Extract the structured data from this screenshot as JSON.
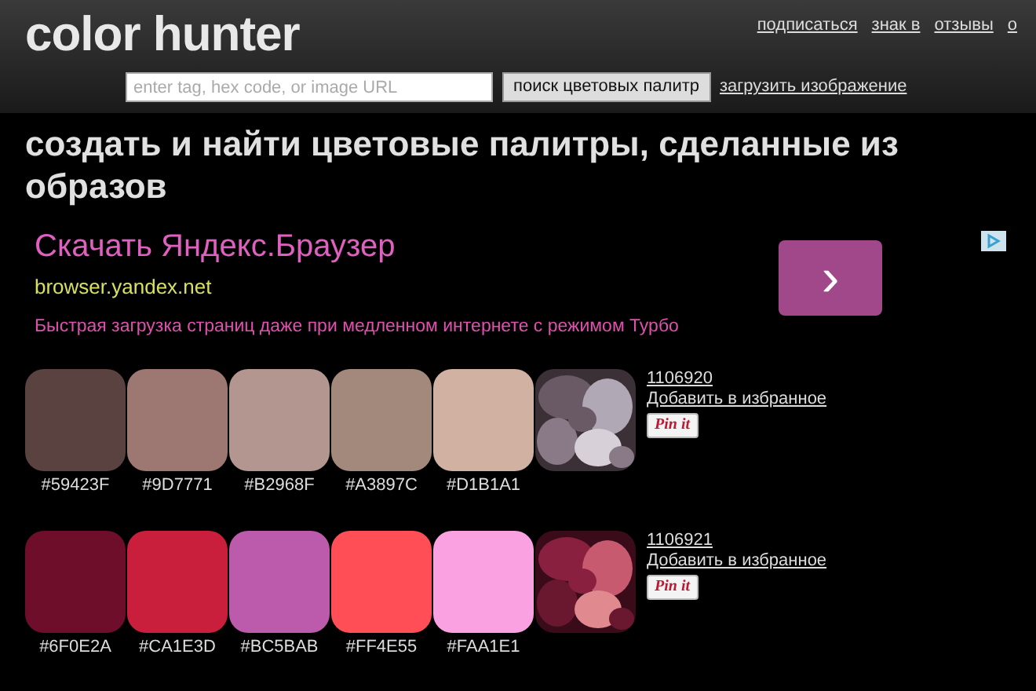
{
  "header": {
    "logo": "color hunter",
    "nav": [
      "подписаться",
      "знак в",
      "отзывы",
      "о"
    ],
    "search": {
      "placeholder": "enter tag, hex code, or image URL"
    },
    "search_button": "поиск цветовых палитр",
    "upload_link": "загрузить изображение"
  },
  "heading": "создать и найти цветовые палитры, сделанные из образов",
  "ad": {
    "title": "Скачать Яндекс.Браузер",
    "url": "browser.yandex.net",
    "description": "Быстрая загрузка страниц даже при медленном интернете с режимом Турбо",
    "button": "›"
  },
  "palettes": [
    {
      "id": "1106920",
      "favorite": "Добавить в избранное",
      "pin": "Pin it",
      "swatches": [
        {
          "label": "#59423F",
          "color": "#59423f"
        },
        {
          "label": "#9D7771",
          "color": "#9d7771"
        },
        {
          "label": "#B2968F",
          "color": "#b2968f"
        },
        {
          "label": "#A3897C",
          "color": "#a3897c"
        },
        {
          "label": "#D1B1A1",
          "color": "#d1b1a1"
        }
      ]
    },
    {
      "id": "1106921",
      "favorite": "Добавить в избранное",
      "pin": "Pin it",
      "swatches": [
        {
          "label": "#6F0E2A",
          "color": "#6f0e2a"
        },
        {
          "label": "#CA1E3D",
          "color": "#ca1e3d"
        },
        {
          "label": "#BC5BAB",
          "color": "#bc5bab"
        },
        {
          "label": "#FF4E55",
          "color": "#ff4e55"
        },
        {
          "label": "#FAA1E1",
          "color": "#faa1e1"
        }
      ]
    }
  ]
}
